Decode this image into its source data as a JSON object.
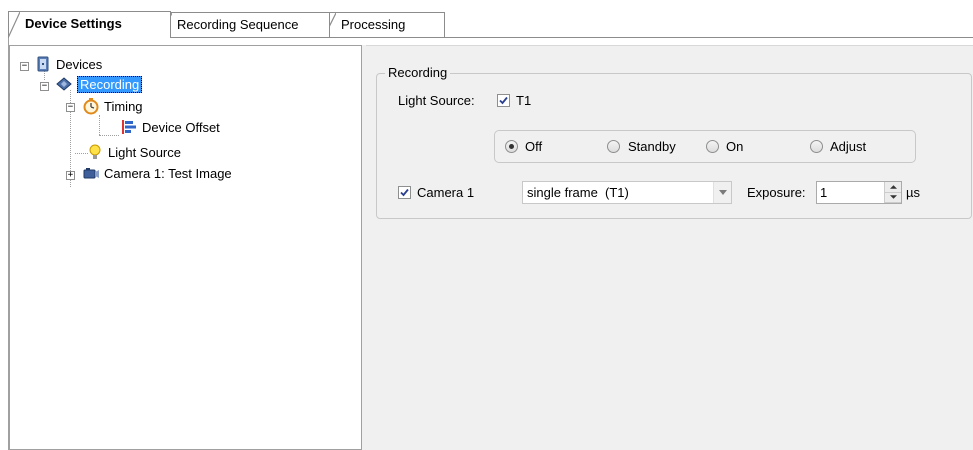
{
  "tabs": [
    {
      "label": "Device Settings",
      "active": true
    },
    {
      "label": "Recording Sequence",
      "active": false
    },
    {
      "label": "Processing",
      "active": false
    }
  ],
  "tree": {
    "root": {
      "label": "Devices",
      "icon": "devices-icon",
      "expanded": true
    },
    "recording": {
      "label": "Recording",
      "icon": "recording-icon",
      "expanded": true,
      "selected": true
    },
    "timing": {
      "label": "Timing",
      "icon": "timer-icon",
      "expanded": true
    },
    "device_offset": {
      "label": "Device Offset",
      "icon": "offset-bars-icon"
    },
    "light_source": {
      "label": "Light Source",
      "icon": "lightbulb-icon"
    },
    "camera": {
      "label": "Camera 1: Test Image",
      "icon": "camera-icon",
      "expanded": false
    }
  },
  "recording_group": {
    "title": "Recording",
    "light_source_label": "Light Source:",
    "light_source_checkbox_label": "T1",
    "light_source_checked": true,
    "modes": [
      {
        "label": "Off",
        "selected": true
      },
      {
        "label": "Standby",
        "selected": false
      },
      {
        "label": "On",
        "selected": false
      },
      {
        "label": "Adjust",
        "selected": false
      }
    ],
    "camera_checkbox_label": "Camera 1",
    "camera_checked": true,
    "frame_mode_value": "single frame  (T1)",
    "exposure_label": "Exposure:",
    "exposure_value": "1",
    "exposure_unit": "µs"
  },
  "colors": {
    "selection": "#3399ff",
    "panel_background": "#f0f0f0"
  }
}
